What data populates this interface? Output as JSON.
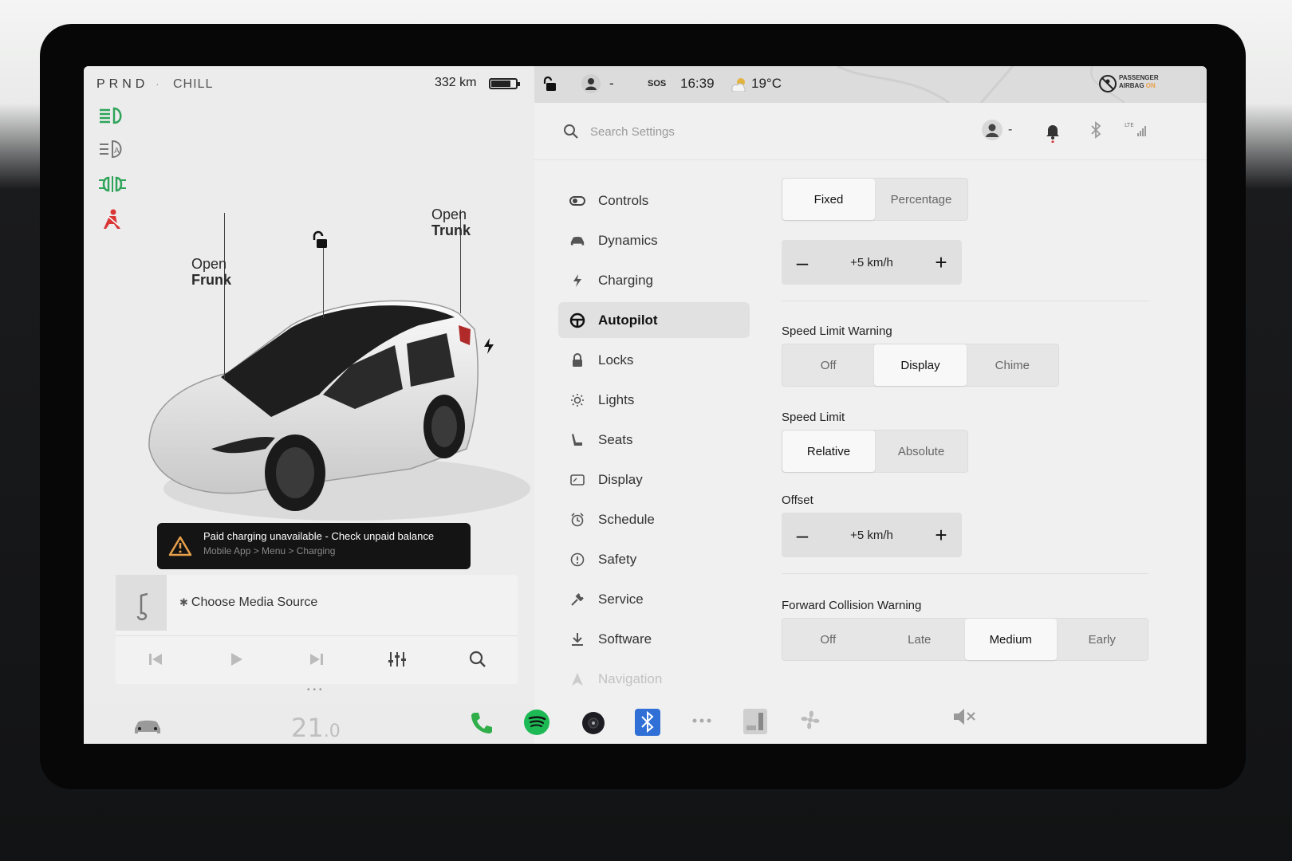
{
  "status_left": {
    "gear": "PRND",
    "drive_mode": "CHILL",
    "range": "332 km",
    "battery_level": 0.8
  },
  "status_right": {
    "profile_dash": "-",
    "sos": "SOS",
    "time": "16:39",
    "temperature": "19°C",
    "airbag_line1": "PASSENGER",
    "airbag_line2": "AIRBAG",
    "airbag_state": "ON"
  },
  "car": {
    "frunk_line1": "Open",
    "frunk_line2": "Frunk",
    "trunk_line1": "Open",
    "trunk_line2": "Trunk"
  },
  "alert": {
    "title": "Paid charging unavailable - Check unpaid balance",
    "subtitle": "Mobile App > Menu > Charging"
  },
  "media": {
    "source_label": "Choose Media Source"
  },
  "search": {
    "placeholder": "Search Settings"
  },
  "header": {
    "profile_dash": "-",
    "lte": "LTE"
  },
  "nav": {
    "items": [
      {
        "label": "Controls",
        "icon": "toggle-icon"
      },
      {
        "label": "Dynamics",
        "icon": "car-icon"
      },
      {
        "label": "Charging",
        "icon": "bolt-icon"
      },
      {
        "label": "Autopilot",
        "icon": "steering-wheel-icon"
      },
      {
        "label": "Locks",
        "icon": "lock-icon"
      },
      {
        "label": "Lights",
        "icon": "sun-icon"
      },
      {
        "label": "Seats",
        "icon": "seat-icon"
      },
      {
        "label": "Display",
        "icon": "display-icon"
      },
      {
        "label": "Schedule",
        "icon": "alarm-icon"
      },
      {
        "label": "Safety",
        "icon": "info-icon"
      },
      {
        "label": "Service",
        "icon": "wrench-icon"
      },
      {
        "label": "Software",
        "icon": "download-icon"
      },
      {
        "label": "Navigation",
        "icon": "navigation-icon"
      }
    ],
    "active": "Autopilot"
  },
  "settings": {
    "offset_mode": {
      "options": [
        "Fixed",
        "Percentage"
      ],
      "selected": "Fixed"
    },
    "top_offset": {
      "value": "+5 km/h",
      "minus": "–",
      "plus": "+"
    },
    "speed_limit_warning": {
      "label": "Speed Limit Warning",
      "options": [
        "Off",
        "Display",
        "Chime"
      ],
      "selected": "Display"
    },
    "speed_limit": {
      "label": "Speed Limit",
      "options": [
        "Relative",
        "Absolute"
      ],
      "selected": "Relative"
    },
    "offset": {
      "label": "Offset",
      "value": "+5 km/h",
      "minus": "–",
      "plus": "+"
    },
    "forward_collision_warning": {
      "label": "Forward Collision Warning",
      "options": [
        "Off",
        "Late",
        "Medium",
        "Early"
      ],
      "selected": "Medium"
    }
  },
  "dock": {
    "cabin_temp_int": "21",
    "cabin_temp_dec": ".0"
  },
  "colors": {
    "tell_green": "#2fa35a",
    "tell_red": "#d93636",
    "phone_green": "#2fae4a",
    "spotify_green": "#1db954",
    "bluetooth_blue": "#2f6fd6"
  }
}
